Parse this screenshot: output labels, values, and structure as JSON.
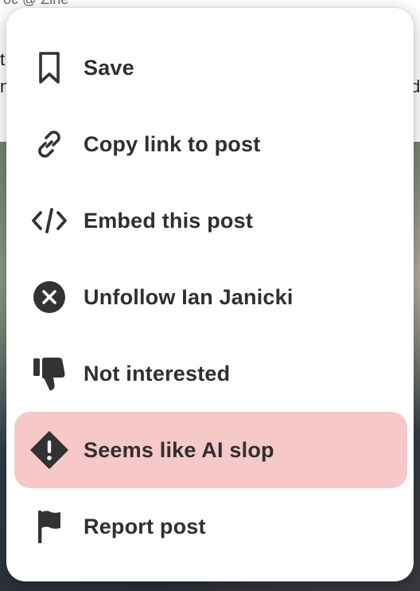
{
  "background": {
    "author_text": "oc @ Zine",
    "left_fragment_1": "t",
    "left_fragment_2": "n",
    "right_fragment": "d"
  },
  "menu": {
    "items": [
      {
        "label": "Save",
        "icon": "bookmark-icon",
        "highlighted": false
      },
      {
        "label": "Copy link to post",
        "icon": "link-icon",
        "highlighted": false
      },
      {
        "label": "Embed this post",
        "icon": "code-icon",
        "highlighted": false
      },
      {
        "label": "Unfollow Ian Janicki",
        "icon": "close-circle-icon",
        "highlighted": false
      },
      {
        "label": "Not interested",
        "icon": "thumbs-down-icon",
        "highlighted": false
      },
      {
        "label": "Seems like AI slop",
        "icon": "warning-diamond-icon",
        "highlighted": true
      },
      {
        "label": "Report post",
        "icon": "flag-icon",
        "highlighted": false
      }
    ],
    "colors": {
      "icon": "#333333",
      "text": "#2f2f2f",
      "highlight_bg": "#f7c8c8"
    }
  }
}
